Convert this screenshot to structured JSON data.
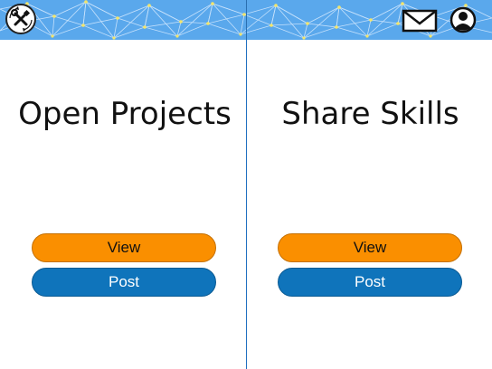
{
  "header": {
    "background_color": "#5aa8ec",
    "logo_icon": "tools-logo-icon",
    "mail_icon": "mail-icon",
    "user_icon": "user-account-icon"
  },
  "panels": [
    {
      "title": "Open Projects",
      "view_label": "View",
      "post_label": "Post"
    },
    {
      "title": "Share Skills",
      "view_label": "View",
      "post_label": "Post"
    }
  ],
  "colors": {
    "view_button": "#fa8f00",
    "post_button": "#0f74bb",
    "divider": "#1f6fc0"
  }
}
